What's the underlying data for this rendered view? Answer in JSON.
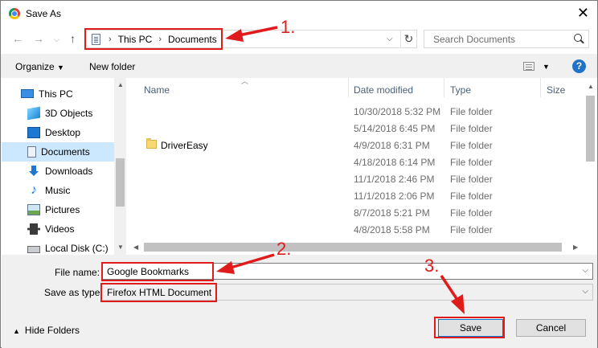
{
  "window": {
    "title": "Save As"
  },
  "address": {
    "crumbs": [
      "This PC",
      "Documents"
    ]
  },
  "search": {
    "placeholder": "Search Documents"
  },
  "toolbar": {
    "organize": "Organize",
    "new_folder": "New folder"
  },
  "nav": {
    "items": [
      {
        "label": "This PC",
        "icon": "computer-icon",
        "selected": false
      },
      {
        "label": "3D Objects",
        "icon": "3d-objects-icon",
        "selected": false
      },
      {
        "label": "Desktop",
        "icon": "desktop-icon",
        "selected": false
      },
      {
        "label": "Documents",
        "icon": "documents-icon",
        "selected": true
      },
      {
        "label": "Downloads",
        "icon": "download-icon",
        "selected": false
      },
      {
        "label": "Music",
        "icon": "music-icon",
        "selected": false
      },
      {
        "label": "Pictures",
        "icon": "pictures-icon",
        "selected": false
      },
      {
        "label": "Videos",
        "icon": "videos-icon",
        "selected": false
      },
      {
        "label": "Local Disk (C:)",
        "icon": "disk-icon",
        "selected": false
      }
    ]
  },
  "columns": {
    "name": "Name",
    "date": "Date modified",
    "type": "Type",
    "size": "Size"
  },
  "files": [
    {
      "name": "",
      "date": "10/30/2018 5:32 PM",
      "type": "File folder"
    },
    {
      "name": "",
      "date": "5/14/2018 6:45 PM",
      "type": "File folder"
    },
    {
      "name": "DriverEasy",
      "date": "4/9/2018 6:31 PM",
      "type": "File folder"
    },
    {
      "name": "",
      "date": "4/18/2018 6:14 PM",
      "type": "File folder"
    },
    {
      "name": "",
      "date": "11/1/2018 2:46 PM",
      "type": "File folder"
    },
    {
      "name": "",
      "date": "11/1/2018 2:06 PM",
      "type": "File folder"
    },
    {
      "name": "",
      "date": "8/7/2018 5:21 PM",
      "type": "File folder"
    },
    {
      "name": "",
      "date": "4/8/2018 5:58 PM",
      "type": "File folder"
    }
  ],
  "form": {
    "file_name_label": "File name:",
    "file_name_value": "Google Bookmarks",
    "save_type_label": "Save as type:",
    "save_type_value": "Firefox HTML Document"
  },
  "footer": {
    "hide_folders": "Hide Folders",
    "save": "Save",
    "cancel": "Cancel"
  },
  "annotations": {
    "step1": "1.",
    "step2": "2.",
    "step3": "3.",
    "color": "#e01b1b"
  }
}
